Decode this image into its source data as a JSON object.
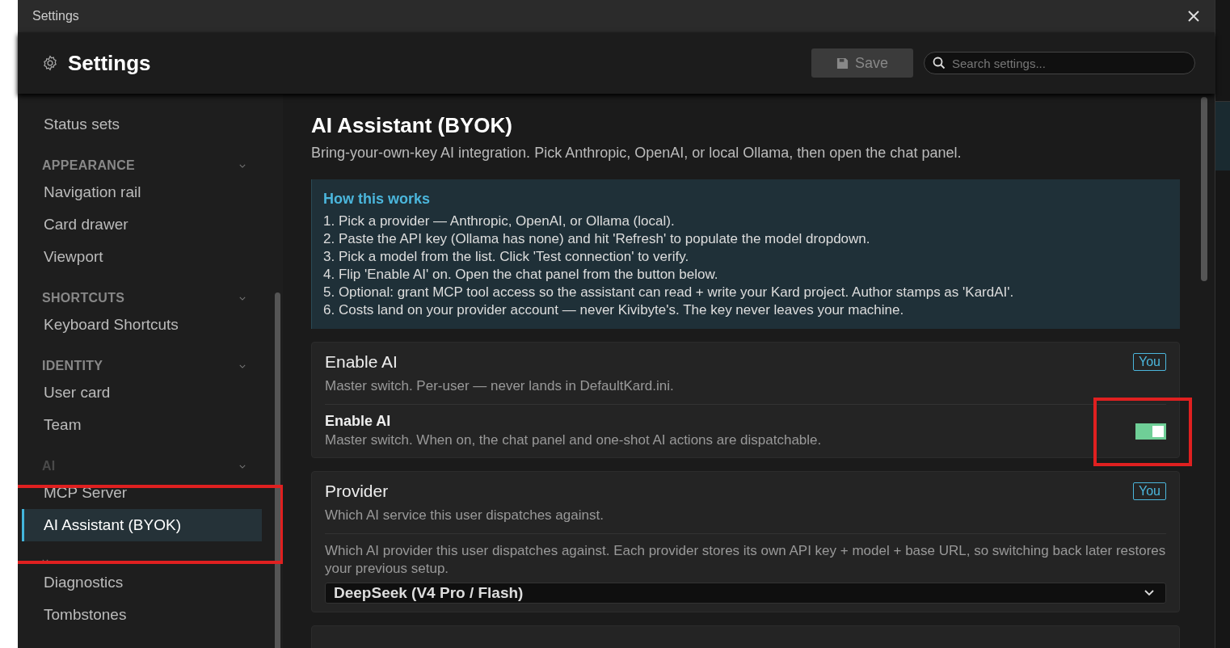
{
  "window": {
    "title": "Settings"
  },
  "header": {
    "title": "Settings",
    "save_button": {
      "label": "Save",
      "disabled": true
    },
    "search": {
      "placeholder": "Search settings..."
    }
  },
  "sidebar": {
    "groups": [
      {
        "items": [
          {
            "label": "Status sets",
            "selected": false,
            "highlighted": false
          }
        ]
      },
      {
        "heading": "APPEARANCE",
        "dimmed": false,
        "items": [
          {
            "label": "Navigation rail",
            "selected": false,
            "highlighted": false
          },
          {
            "label": "Card drawer",
            "selected": false,
            "highlighted": false
          },
          {
            "label": "Viewport",
            "selected": false,
            "highlighted": false
          }
        ]
      },
      {
        "heading": "SHORTCUTS",
        "dimmed": false,
        "items": [
          {
            "label": "Keyboard Shortcuts",
            "selected": false,
            "highlighted": false
          }
        ]
      },
      {
        "heading": "IDENTITY",
        "dimmed": false,
        "items": [
          {
            "label": "User card",
            "selected": false,
            "highlighted": false
          },
          {
            "label": "Team",
            "selected": false,
            "highlighted": false
          }
        ]
      },
      {
        "heading": "AI",
        "dimmed": true,
        "items": [
          {
            "label": "MCP Server",
            "selected": false,
            "highlighted": false
          },
          {
            "label": "AI Assistant (BYOK)",
            "selected": true,
            "highlighted": true
          }
        ]
      },
      {
        "collapsible": true,
        "items": [
          {
            "label": "Diagnostics",
            "selected": false,
            "highlighted": false
          },
          {
            "label": "Tombstones",
            "selected": false,
            "highlighted": false
          }
        ]
      }
    ]
  },
  "content": {
    "title": "AI Assistant (BYOK)",
    "subtitle": "Bring-your-own-key AI integration. Pick Anthropic, OpenAI, or local Ollama, then open the chat panel.",
    "info": {
      "title": "How this works",
      "lines": [
        "1. Pick a provider — Anthropic, OpenAI, or Ollama (local).",
        "2. Paste the API key (Ollama has none) and hit 'Refresh' to populate the model dropdown.",
        "3. Pick a model from the list. Click 'Test connection' to verify.",
        "4. Flip 'Enable AI' on. Open the chat panel from the button below.",
        "5. Optional: grant MCP tool access so the assistant can read + write your Kard project. Author stamps as 'KardAI'.",
        "6. Costs land on your provider account — never Kivibyte's. The key never leaves your machine."
      ]
    },
    "cards": [
      {
        "kind": "toggle",
        "title": "Enable AI",
        "description": "Master switch. Per-user — never lands in DefaultKard.ini.",
        "badge": "You",
        "setting": {
          "label": "Enable AI",
          "description": "Master switch. When on, the chat panel and one-shot AI actions are dispatchable.",
          "on": true,
          "highlighted": true
        }
      },
      {
        "kind": "select",
        "title": "Provider",
        "description": "Which AI service this user dispatches against.",
        "badge": "You",
        "detail": "Which AI provider this user dispatches against. Each provider stores its own API key + model + base URL, so switching back later restores your previous setup.",
        "value": "DeepSeek (V4 Pro / Flash)"
      },
      {
        "kind": "plain"
      }
    ]
  }
}
